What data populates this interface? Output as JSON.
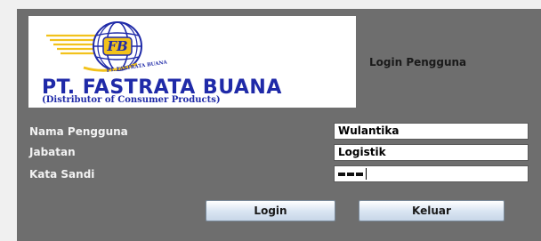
{
  "logo": {
    "badge_text": "PT. FASTRATA BUANA",
    "company_name": "PT. FASTRATA BUANA",
    "tagline": "(Distributor of Consumer Products)"
  },
  "title": "Login Pengguna",
  "form": {
    "username": {
      "label": "Nama Pengguna",
      "value": "Wulantika"
    },
    "position": {
      "label": "Jabatan",
      "value": "Logistik"
    },
    "password": {
      "label": "Kata Sandi",
      "masked_chars": 3
    }
  },
  "buttons": {
    "login": "Login",
    "exit": "Keluar"
  },
  "colors": {
    "panel": "#6e6e6e",
    "brand_blue": "#1f2aa8",
    "logo_yellow": "#f2c21b"
  }
}
